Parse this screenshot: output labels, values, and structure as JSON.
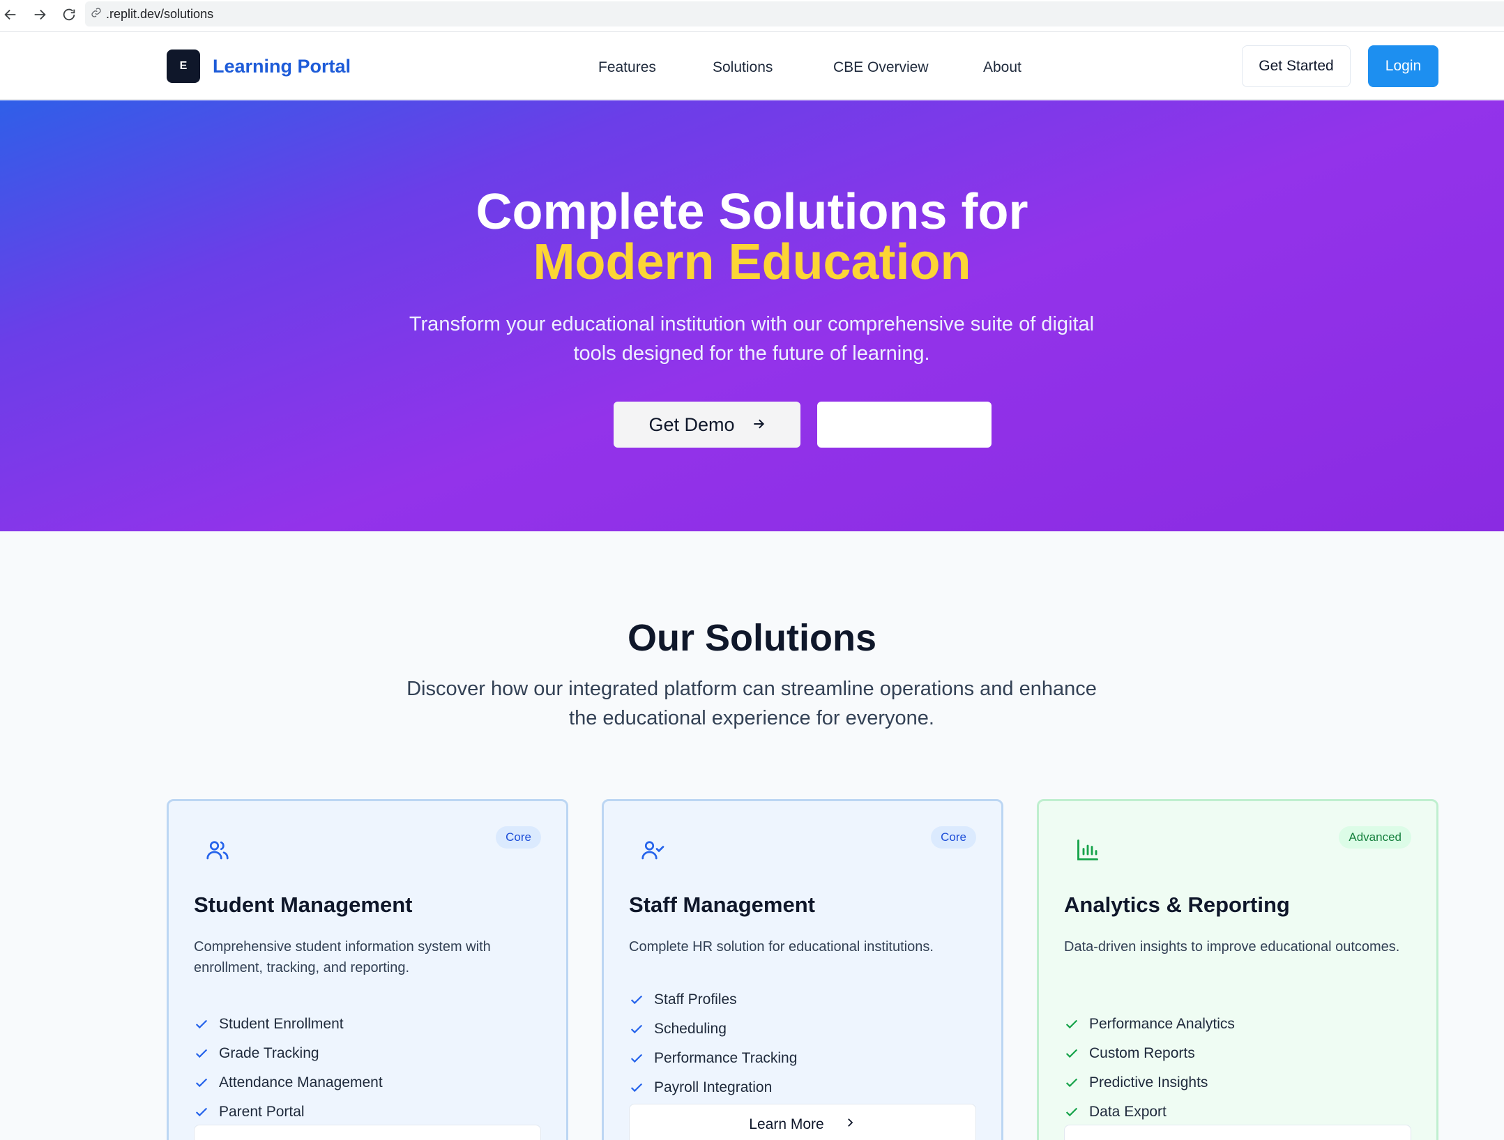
{
  "browser": {
    "url": ".replit.dev/solutions"
  },
  "navbar": {
    "logo_letter": "E",
    "brand": "Learning Portal",
    "links": [
      "Features",
      "Solutions",
      "CBE Overview",
      "About"
    ],
    "get_started": "Get Started",
    "login": "Login"
  },
  "hero": {
    "title_line1": "Complete Solutions for",
    "title_line2": "Modern Education",
    "subtitle": "Transform your educational institution with our comprehensive suite of digital tools designed for the future of learning.",
    "demo_button": "Get Demo",
    "secondary_button": ""
  },
  "solutions": {
    "title": "Our Solutions",
    "subtitle": "Discover how our integrated platform can streamline operations and enhance the educational experience for everyone.",
    "cards": [
      {
        "icon": "users-icon",
        "badge": "Core",
        "title": "Student Management",
        "description": "Comprehensive student information system with enrollment, tracking, and reporting.",
        "features": [
          "Student Enrollment",
          "Grade Tracking",
          "Attendance Management",
          "Parent Portal"
        ]
      },
      {
        "icon": "user-check-icon",
        "badge": "Core",
        "title": "Staff Management",
        "description": "Complete HR solution for educational institutions.",
        "features": [
          "Staff Profiles",
          "Scheduling",
          "Performance Tracking",
          "Payroll Integration"
        ],
        "learn_more": "Learn More"
      },
      {
        "icon": "bar-chart-icon",
        "badge": "Advanced",
        "title": "Analytics & Reporting",
        "description": "Data-driven insights to improve educational outcomes.",
        "features": [
          "Performance Analytics",
          "Custom Reports",
          "Predictive Insights",
          "Data Export"
        ]
      }
    ]
  },
  "colors": {
    "brand_blue": "#1d5bd8",
    "login_blue": "#1d8ff0",
    "hero_gradient_start": "#2f5fe8",
    "hero_gradient_end": "#9333ea",
    "highlight_yellow": "#fcd535",
    "core_badge": "#1d4ed8",
    "advanced_badge": "#15803d"
  }
}
